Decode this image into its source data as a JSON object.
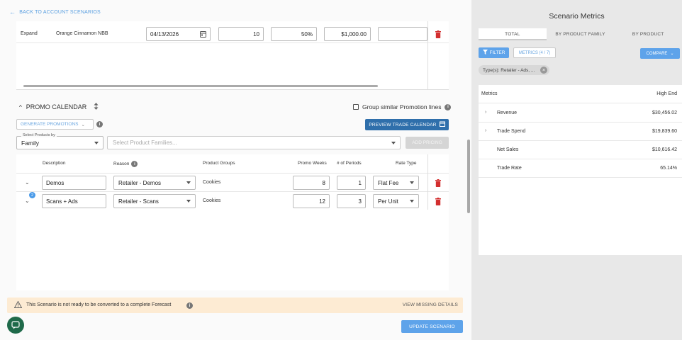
{
  "nav": {
    "back_label": "BACK TO ACCOUNT SCENARIOS"
  },
  "top_row": {
    "type": "Expand",
    "product": "Orange Cinnamon NBB",
    "date": "04/13/2026",
    "qty": "10",
    "pct": "50%",
    "amount": "$1,000.00",
    "extra": ""
  },
  "promo": {
    "title": "PROMO CALENDAR",
    "group_label": "Group similar Promotion lines",
    "generate_label": "GENERATE PROMOTIONS",
    "preview_label": "PREVIEW TRADE CALENDAR",
    "select_by_label": "Select Products by",
    "select_by_value": "Family",
    "families_placeholder": "Select Product Families...",
    "add_label": "ADD PRICING",
    "columns": {
      "description": "Description",
      "reason": "Reason",
      "groups": "Product Groups",
      "weeks": "Promo Weeks",
      "periods": "# of Periods",
      "rate": "Rate Type"
    },
    "rows": [
      {
        "description": "Demos",
        "reason": "Retailer - Demos",
        "groups": "Cookies",
        "weeks": "8",
        "periods": "1",
        "rate": "Flat Fee",
        "badge": ""
      },
      {
        "description": "Scans + Ads",
        "reason": "Retailer - Scans",
        "groups": "Cookies",
        "weeks": "12",
        "periods": "3",
        "rate": "Per Unit",
        "badge": "2"
      }
    ]
  },
  "warning": {
    "text": "This Scenario is not ready to be converted to a complete Forecast",
    "action": "VIEW MISSING DETAILS"
  },
  "update_label": "UPDATE SCENARIO",
  "panel": {
    "title": "Scenario Metrics",
    "tabs": [
      "TOTAL",
      "BY PRODUCT FAMILY",
      "BY PRODUCT"
    ],
    "filter_label": "FILTER",
    "metrics_label": "METRICS (4 / 7)",
    "compare_label": "COMPARE",
    "chip_label": "Type(s): Retailer - Ads, ...",
    "header_metric": "Metrics",
    "header_value": "High End",
    "rows": [
      {
        "label": "Revenue",
        "value": "$30,456.02"
      },
      {
        "label": "Trade Spend",
        "value": "$19,839.60"
      },
      {
        "label": "Net Sales",
        "value": "$10,616.42"
      },
      {
        "label": "Trade Rate",
        "value": "65.14%"
      }
    ]
  },
  "colors": {
    "accent": "#5ea3ea",
    "primary_dark": "#2f6fab",
    "delete": "#d32f2f",
    "warning_bg": "#fdebd3"
  }
}
